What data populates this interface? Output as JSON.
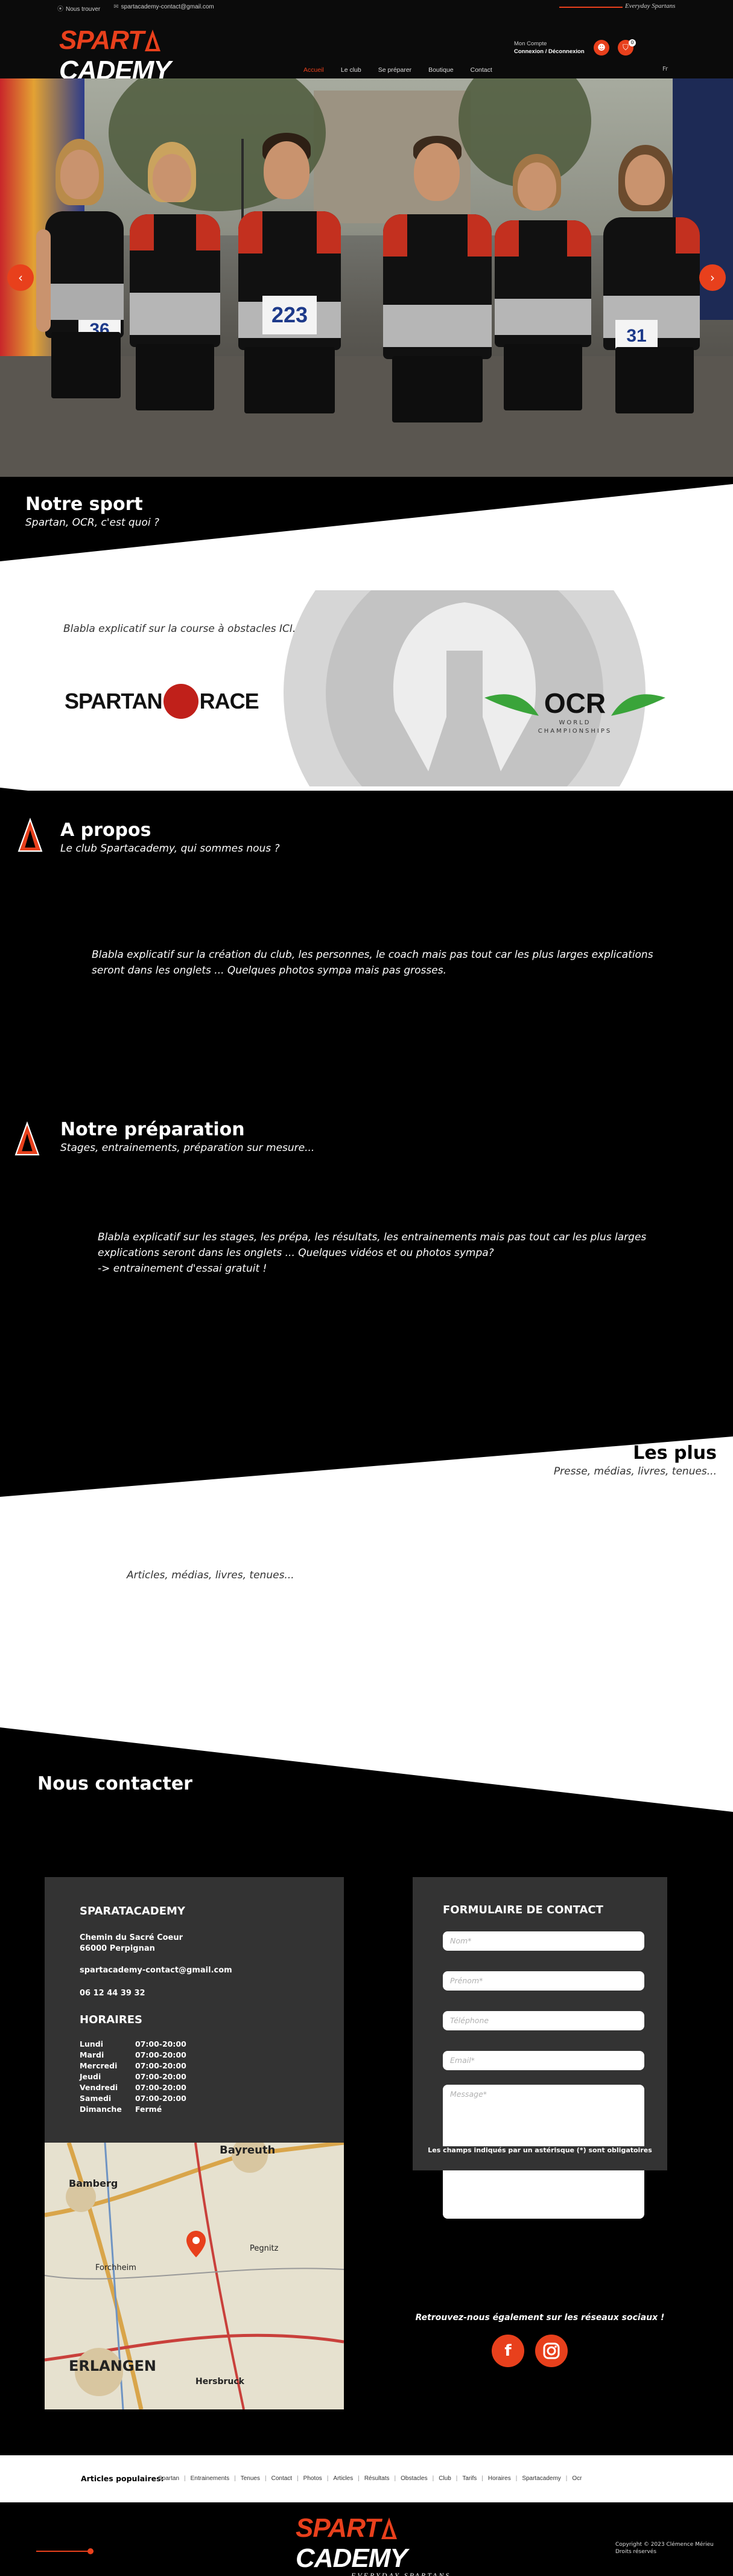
{
  "topbar": {
    "address": "Nous trouver",
    "email": "spartacademy-contact@gmail.com",
    "slogan": "Everyday Spartans",
    "account_label": "Mon Compte",
    "account_link": "Connexion / Déconnexion",
    "cart_count": "0",
    "lang": "Fr"
  },
  "logo": {
    "part1": "SPART",
    "part2": "CADEMY",
    "tagline": "EVERYDAY SPARTANS"
  },
  "nav": [
    "Accueil",
    "Le club",
    "Se préparer",
    "Boutique",
    "Contact"
  ],
  "hero": {
    "bibs": [
      "36",
      "223",
      "31"
    ],
    "prev_icon": "chevron-left-icon",
    "next_icon": "chevron-right-icon"
  },
  "sport": {
    "title": "Notre sport",
    "subtitle": "Spartan, OCR, c'est quoi ?",
    "text": "Blabla explicatif sur la course à obstacles ICI.",
    "spartan_logo_a": "SPARTAN",
    "spartan_logo_b": "RACE",
    "ocr_logo": "OCR",
    "ocr_logo_sub1": "WORLD",
    "ocr_logo_sub2": "CHAMPIONSHIPS"
  },
  "about": {
    "title": "A propos",
    "subtitle": "Le club Spartacademy, qui sommes nous ?",
    "text1": "Blabla explicatif sur la création du club, les personnes, le coach mais pas tout car les plus larges explications",
    "text2": "seront dans les onglets ... Quelques photos sympa mais pas grosses."
  },
  "prep": {
    "title": "Notre préparation",
    "subtitle": "Stages, entrainements, préparation sur mesure...",
    "text1": "Blabla explicatif sur les stages, les prépa, les résultats, les entrainements mais pas tout car les plus larges",
    "text2": "explications seront dans les onglets ... Quelques vidéos et ou photos sympa?",
    "text3": "-> entrainement d'essai gratuit !"
  },
  "plus": {
    "title": "Les plus",
    "subtitle": "Presse, médias, livres, tenues...",
    "text": "Articles, médias, livres, tenues..."
  },
  "contact": {
    "title": "Nous contacter",
    "name": "SPARATACADEMY",
    "addr1": "Chemin du Sacré Coeur",
    "addr2": "66000 Perpignan",
    "email": "spartacademy-contact@gmail.com",
    "phone": "06 12 44 39 32",
    "hours_title": "HORAIRES",
    "hours": [
      {
        "day": "Lundi",
        "time": "07:00-20:00"
      },
      {
        "day": "Mardi",
        "time": "07:00-20:00"
      },
      {
        "day": "Mercredi",
        "time": "07:00-20:00"
      },
      {
        "day": "Jeudi",
        "time": "07:00-20:00"
      },
      {
        "day": "Vendredi",
        "time": "07:00-20:00"
      },
      {
        "day": "Samedi",
        "time": "07:00-20:00"
      },
      {
        "day": "Dimanche",
        "time": "Fermé"
      }
    ],
    "map_labels": [
      "Bayreuth",
      "Bamberg",
      "Forchheim",
      "Pegnitz",
      "ERLANGEN",
      "Hersbruck"
    ]
  },
  "form": {
    "title": "FORMULAIRE DE CONTACT",
    "ph_name": "Nom*",
    "ph_first": "Prénom*",
    "ph_phone": "Téléphone",
    "ph_email": "Email*",
    "ph_message": "Message*",
    "note": "Les champs indiqués par un astérisque (*) sont obligatoires",
    "social_text": "Retrouvez-nous également sur les réseaux sociaux !"
  },
  "popular": {
    "label": "Articles populaires:",
    "links": [
      "Spartan",
      "Entrainements",
      "Tenues",
      "Contact",
      "Photos",
      "Articles",
      "Résultats",
      "Obstacles",
      "Club",
      "Tarifs",
      "Horaires",
      "Spartacademy",
      "Ocr"
    ]
  },
  "footer": {
    "copyright": "Copyright © 2023 Clémence Mérieu",
    "rights": "Droits réservés"
  },
  "colors": {
    "accent": "#e8401c",
    "dark": "#000000",
    "card": "#333333"
  }
}
